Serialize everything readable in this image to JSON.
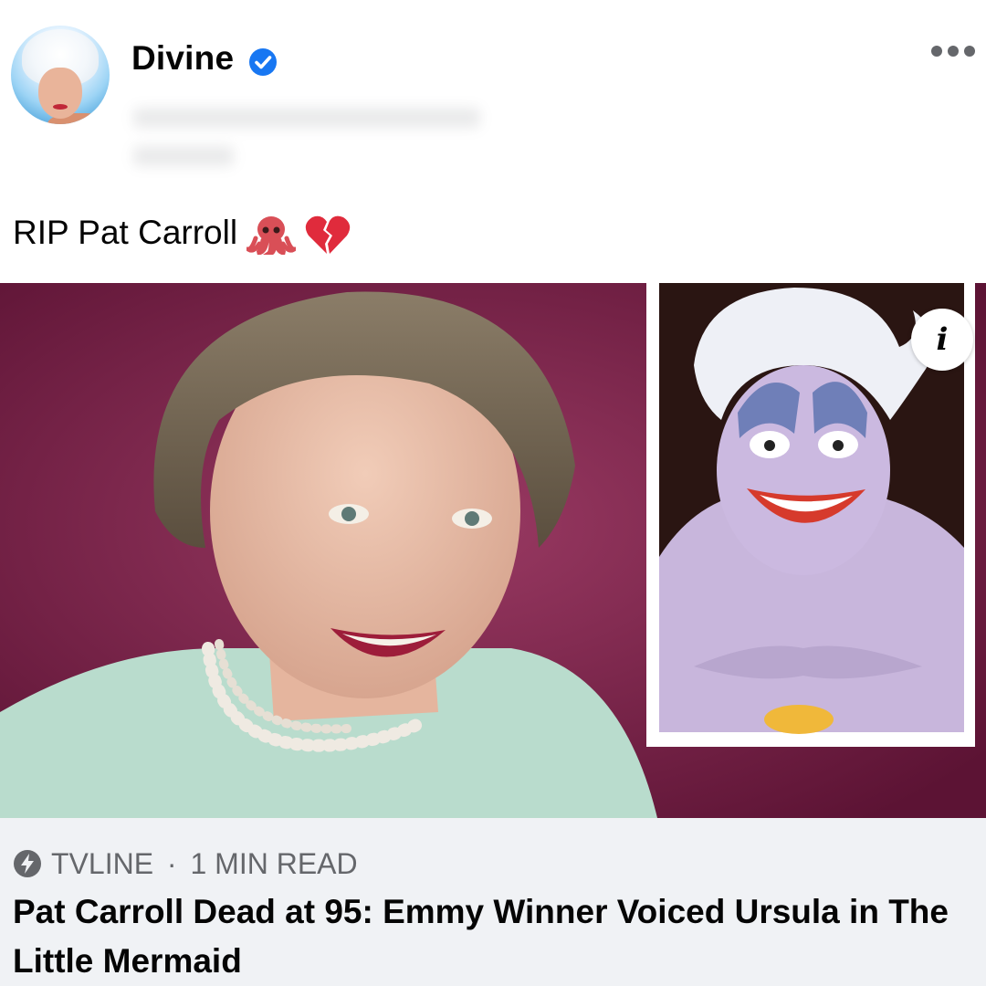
{
  "post": {
    "author": "Divine",
    "text": "RIP Pat Carroll",
    "emojis": [
      "octopus-icon",
      "broken-heart-icon"
    ]
  },
  "link": {
    "source": "TVLINE",
    "separator": "·",
    "read_time": "1 MIN READ",
    "headline": "Pat Carroll Dead at 95: Emmy Winner Voiced Ursula in The Little Mermaid",
    "info_label": "i"
  },
  "colors": {
    "verified": "#1877f2",
    "caption_bg": "#f0f2f5",
    "secondary_text": "#65676b",
    "image_backdrop": "#7d2048"
  }
}
